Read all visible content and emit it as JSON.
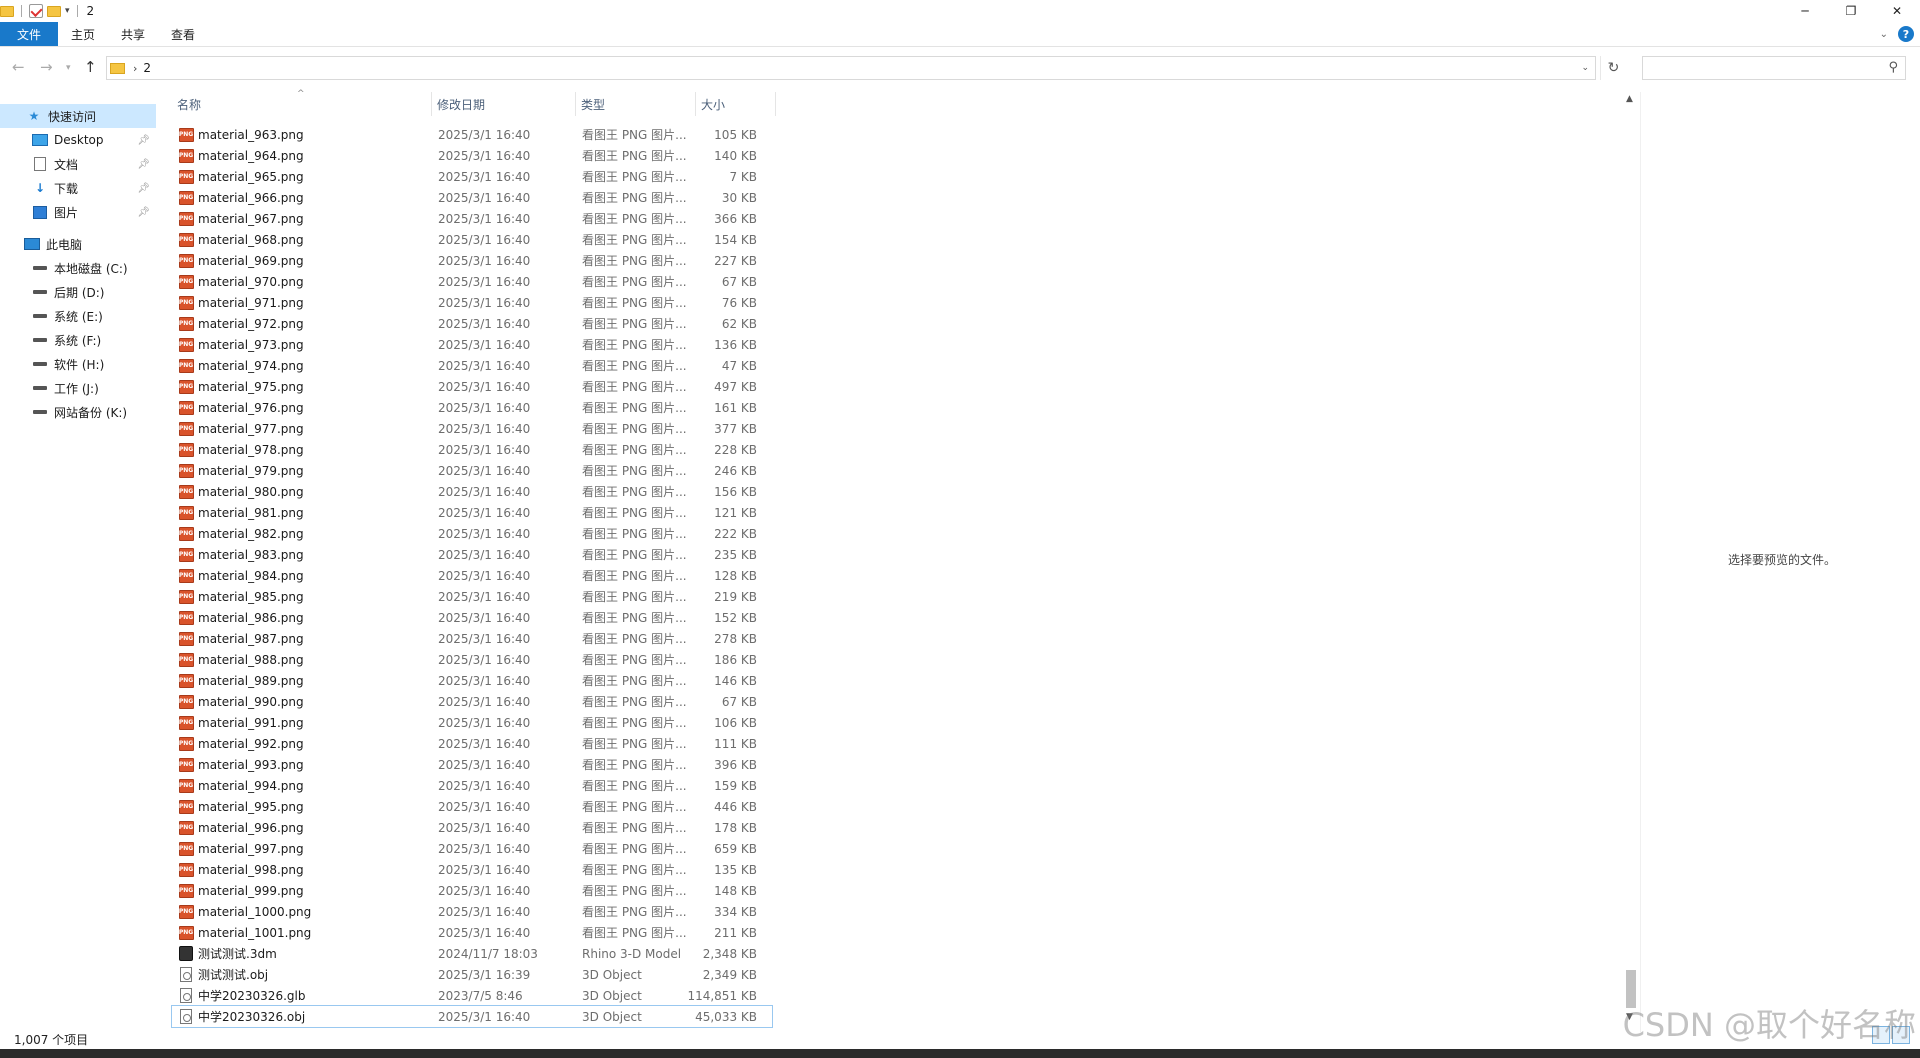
{
  "window": {
    "title": "2",
    "controls": [
      "minimize-icon",
      "restore-icon",
      "close-icon"
    ]
  },
  "ribbon": {
    "tabs": [
      "文件",
      "主页",
      "共享",
      "查看"
    ]
  },
  "address": {
    "path": "2",
    "search_placeholder": ""
  },
  "sidebar": {
    "quick_access": "快速访问",
    "quick_items": [
      "Desktop",
      "文档",
      "下载",
      "图片"
    ],
    "this_pc": "此电脑",
    "drives": [
      "本地磁盘 (C:)",
      "后期 (D:)",
      "系统 (E:)",
      "系统 (F:)",
      "软件 (H:)",
      "工作 (J:)",
      "网站备份 (K:)"
    ]
  },
  "columns": {
    "name": "名称",
    "date": "修改日期",
    "type": "类型",
    "size": "大小"
  },
  "files": [
    {
      "name": "material_963.png",
      "date": "2025/3/1 16:40",
      "type": "看图王 PNG 图片...",
      "size": "105 KB",
      "icon": "png"
    },
    {
      "name": "material_964.png",
      "date": "2025/3/1 16:40",
      "type": "看图王 PNG 图片...",
      "size": "140 KB",
      "icon": "png"
    },
    {
      "name": "material_965.png",
      "date": "2025/3/1 16:40",
      "type": "看图王 PNG 图片...",
      "size": "7 KB",
      "icon": "png"
    },
    {
      "name": "material_966.png",
      "date": "2025/3/1 16:40",
      "type": "看图王 PNG 图片...",
      "size": "30 KB",
      "icon": "png"
    },
    {
      "name": "material_967.png",
      "date": "2025/3/1 16:40",
      "type": "看图王 PNG 图片...",
      "size": "366 KB",
      "icon": "png"
    },
    {
      "name": "material_968.png",
      "date": "2025/3/1 16:40",
      "type": "看图王 PNG 图片...",
      "size": "154 KB",
      "icon": "png"
    },
    {
      "name": "material_969.png",
      "date": "2025/3/1 16:40",
      "type": "看图王 PNG 图片...",
      "size": "227 KB",
      "icon": "png"
    },
    {
      "name": "material_970.png",
      "date": "2025/3/1 16:40",
      "type": "看图王 PNG 图片...",
      "size": "67 KB",
      "icon": "png"
    },
    {
      "name": "material_971.png",
      "date": "2025/3/1 16:40",
      "type": "看图王 PNG 图片...",
      "size": "76 KB",
      "icon": "png"
    },
    {
      "name": "material_972.png",
      "date": "2025/3/1 16:40",
      "type": "看图王 PNG 图片...",
      "size": "62 KB",
      "icon": "png"
    },
    {
      "name": "material_973.png",
      "date": "2025/3/1 16:40",
      "type": "看图王 PNG 图片...",
      "size": "136 KB",
      "icon": "png"
    },
    {
      "name": "material_974.png",
      "date": "2025/3/1 16:40",
      "type": "看图王 PNG 图片...",
      "size": "47 KB",
      "icon": "png"
    },
    {
      "name": "material_975.png",
      "date": "2025/3/1 16:40",
      "type": "看图王 PNG 图片...",
      "size": "497 KB",
      "icon": "png"
    },
    {
      "name": "material_976.png",
      "date": "2025/3/1 16:40",
      "type": "看图王 PNG 图片...",
      "size": "161 KB",
      "icon": "png"
    },
    {
      "name": "material_977.png",
      "date": "2025/3/1 16:40",
      "type": "看图王 PNG 图片...",
      "size": "377 KB",
      "icon": "png"
    },
    {
      "name": "material_978.png",
      "date": "2025/3/1 16:40",
      "type": "看图王 PNG 图片...",
      "size": "228 KB",
      "icon": "png"
    },
    {
      "name": "material_979.png",
      "date": "2025/3/1 16:40",
      "type": "看图王 PNG 图片...",
      "size": "246 KB",
      "icon": "png"
    },
    {
      "name": "material_980.png",
      "date": "2025/3/1 16:40",
      "type": "看图王 PNG 图片...",
      "size": "156 KB",
      "icon": "png"
    },
    {
      "name": "material_981.png",
      "date": "2025/3/1 16:40",
      "type": "看图王 PNG 图片...",
      "size": "121 KB",
      "icon": "png"
    },
    {
      "name": "material_982.png",
      "date": "2025/3/1 16:40",
      "type": "看图王 PNG 图片...",
      "size": "222 KB",
      "icon": "png"
    },
    {
      "name": "material_983.png",
      "date": "2025/3/1 16:40",
      "type": "看图王 PNG 图片...",
      "size": "235 KB",
      "icon": "png"
    },
    {
      "name": "material_984.png",
      "date": "2025/3/1 16:40",
      "type": "看图王 PNG 图片...",
      "size": "128 KB",
      "icon": "png"
    },
    {
      "name": "material_985.png",
      "date": "2025/3/1 16:40",
      "type": "看图王 PNG 图片...",
      "size": "219 KB",
      "icon": "png"
    },
    {
      "name": "material_986.png",
      "date": "2025/3/1 16:40",
      "type": "看图王 PNG 图片...",
      "size": "152 KB",
      "icon": "png"
    },
    {
      "name": "material_987.png",
      "date": "2025/3/1 16:40",
      "type": "看图王 PNG 图片...",
      "size": "278 KB",
      "icon": "png"
    },
    {
      "name": "material_988.png",
      "date": "2025/3/1 16:40",
      "type": "看图王 PNG 图片...",
      "size": "186 KB",
      "icon": "png"
    },
    {
      "name": "material_989.png",
      "date": "2025/3/1 16:40",
      "type": "看图王 PNG 图片...",
      "size": "146 KB",
      "icon": "png"
    },
    {
      "name": "material_990.png",
      "date": "2025/3/1 16:40",
      "type": "看图王 PNG 图片...",
      "size": "67 KB",
      "icon": "png"
    },
    {
      "name": "material_991.png",
      "date": "2025/3/1 16:40",
      "type": "看图王 PNG 图片...",
      "size": "106 KB",
      "icon": "png"
    },
    {
      "name": "material_992.png",
      "date": "2025/3/1 16:40",
      "type": "看图王 PNG 图片...",
      "size": "111 KB",
      "icon": "png"
    },
    {
      "name": "material_993.png",
      "date": "2025/3/1 16:40",
      "type": "看图王 PNG 图片...",
      "size": "396 KB",
      "icon": "png"
    },
    {
      "name": "material_994.png",
      "date": "2025/3/1 16:40",
      "type": "看图王 PNG 图片...",
      "size": "159 KB",
      "icon": "png"
    },
    {
      "name": "material_995.png",
      "date": "2025/3/1 16:40",
      "type": "看图王 PNG 图片...",
      "size": "446 KB",
      "icon": "png"
    },
    {
      "name": "material_996.png",
      "date": "2025/3/1 16:40",
      "type": "看图王 PNG 图片...",
      "size": "178 KB",
      "icon": "png"
    },
    {
      "name": "material_997.png",
      "date": "2025/3/1 16:40",
      "type": "看图王 PNG 图片...",
      "size": "659 KB",
      "icon": "png"
    },
    {
      "name": "material_998.png",
      "date": "2025/3/1 16:40",
      "type": "看图王 PNG 图片...",
      "size": "135 KB",
      "icon": "png"
    },
    {
      "name": "material_999.png",
      "date": "2025/3/1 16:40",
      "type": "看图王 PNG 图片...",
      "size": "148 KB",
      "icon": "png"
    },
    {
      "name": "material_1000.png",
      "date": "2025/3/1 16:40",
      "type": "看图王 PNG 图片...",
      "size": "334 KB",
      "icon": "png"
    },
    {
      "name": "material_1001.png",
      "date": "2025/3/1 16:40",
      "type": "看图王 PNG 图片...",
      "size": "211 KB",
      "icon": "png"
    },
    {
      "name": "测试测试.3dm",
      "date": "2024/11/7 18:03",
      "type": "Rhino 3-D Model",
      "size": "2,348 KB",
      "icon": "rhino"
    },
    {
      "name": "测试测试.obj",
      "date": "2025/3/1 16:39",
      "type": "3D Object",
      "size": "2,349 KB",
      "icon": "obj"
    },
    {
      "name": "中学20230326.glb",
      "date": "2023/7/5 8:46",
      "type": "3D Object",
      "size": "114,851 KB",
      "icon": "obj"
    },
    {
      "name": "中学20230326.obj",
      "date": "2025/3/1 16:40",
      "type": "3D Object",
      "size": "45,033 KB",
      "icon": "obj",
      "selected": true
    }
  ],
  "preview": {
    "message": "选择要预览的文件。"
  },
  "status": {
    "count": "1,007 个项目"
  },
  "watermark": "CSDN @取个好名称"
}
